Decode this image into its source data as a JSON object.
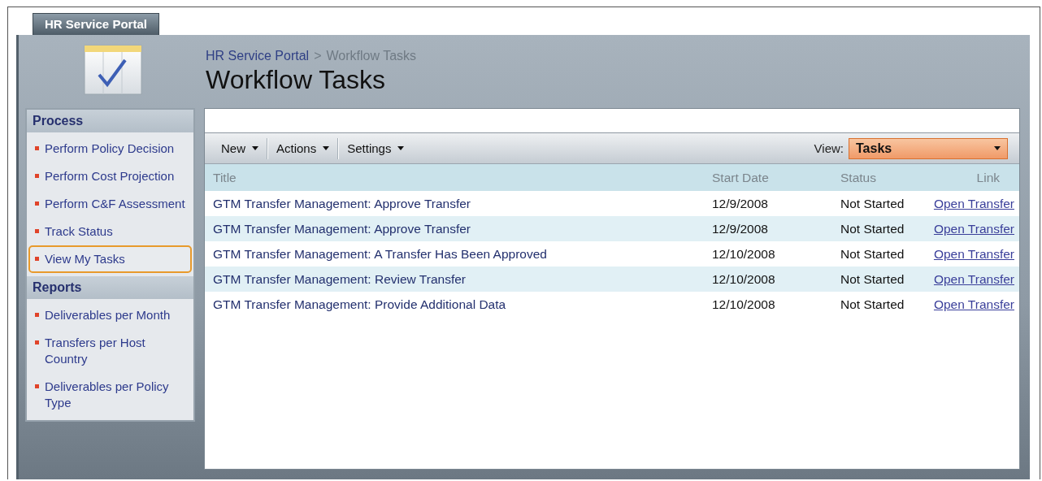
{
  "tab": {
    "label": "HR Service Portal",
    "selected": true
  },
  "breadcrumb": [
    {
      "label": "HR Service Portal",
      "kind": "link"
    },
    {
      "label": ">",
      "kind": "separator"
    },
    {
      "label": "Workflow Tasks",
      "kind": "current"
    }
  ],
  "page_title": "Workflow Tasks",
  "sidebar": {
    "sections": [
      {
        "heading": "Process",
        "items": [
          {
            "label": "Perform Policy Decision",
            "selected": false
          },
          {
            "label": "Perform Cost Projection",
            "selected": false
          },
          {
            "label": "Perform C&F Assessment",
            "selected": false
          },
          {
            "label": "Track Status",
            "selected": false
          },
          {
            "label": "View My Tasks",
            "selected": true
          }
        ]
      },
      {
        "heading": "Reports",
        "items": [
          {
            "label": "Deliverables per Month",
            "selected": false
          },
          {
            "label": "Transfers per Host Country",
            "selected": false
          },
          {
            "label": "Deliverables per Policy Type",
            "selected": false
          }
        ]
      }
    ]
  },
  "toolbar": {
    "menus": [
      {
        "label": "New"
      },
      {
        "label": "Actions"
      },
      {
        "label": "Settings"
      }
    ],
    "view": {
      "label": "View:",
      "value": "Tasks"
    }
  },
  "table": {
    "columns": [
      "Title",
      "Start Date",
      "Status",
      "Link"
    ],
    "rows": [
      {
        "title": "GTM Transfer Management: Approve Transfer",
        "start_date": "12/9/2008",
        "status": "Not Started",
        "link": "Open Transfer"
      },
      {
        "title": "GTM Transfer Management: Approve Transfer",
        "start_date": "12/9/2008",
        "status": "Not Started",
        "link": "Open Transfer"
      },
      {
        "title": "GTM Transfer Management: A Transfer Has Been Approved",
        "start_date": "12/10/2008",
        "status": "Not Started",
        "link": "Open Transfer"
      },
      {
        "title": "GTM Transfer Management: Review Transfer",
        "start_date": "12/10/2008",
        "status": "Not Started",
        "link": "Open Transfer"
      },
      {
        "title": "GTM Transfer Management: Provide Additional Data",
        "start_date": "12/10/2008",
        "status": "Not Started",
        "link": "Open Transfer"
      }
    ]
  }
}
